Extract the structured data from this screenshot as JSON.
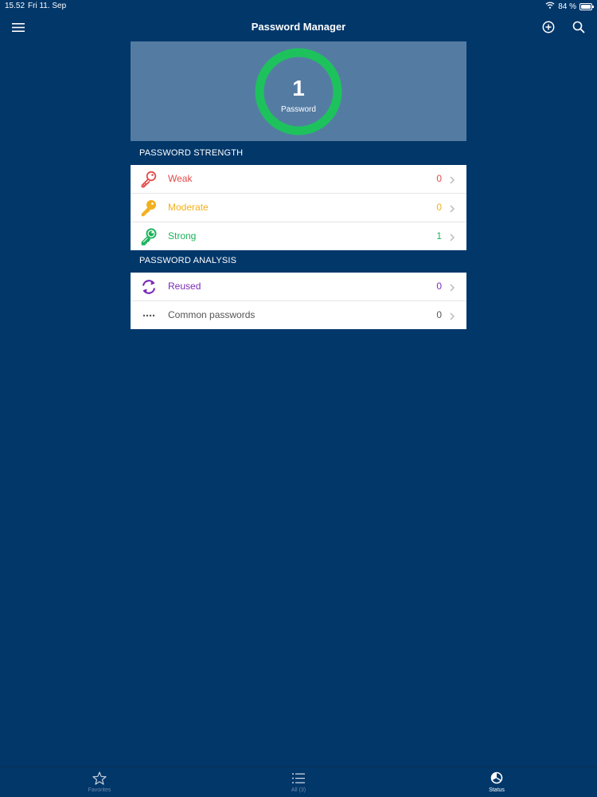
{
  "status_bar": {
    "time": "15.52",
    "date": "Fri 11. Sep",
    "battery": "84 %"
  },
  "nav": {
    "title": "Password Manager",
    "menu_icon": "hamburger-icon",
    "add_icon": "add-circle-icon",
    "search_icon": "search-icon"
  },
  "summary": {
    "count": "1",
    "label": "Password",
    "ring_color": "#1ec25d"
  },
  "strength": {
    "header": "PASSWORD STRENGTH",
    "items": [
      {
        "label": "Weak",
        "count": "0",
        "color": "#e24a4a",
        "icon": "key-icon"
      },
      {
        "label": "Moderate",
        "count": "0",
        "color": "#f2b01e",
        "icon": "key-icon"
      },
      {
        "label": "Strong",
        "count": "1",
        "color": "#1ab35a",
        "icon": "key-icon"
      }
    ]
  },
  "analysis": {
    "header": "PASSWORD ANALYSIS",
    "items": [
      {
        "label": "Reused",
        "count": "0",
        "color": "#7a2bb7",
        "icon": "refresh-icon"
      },
      {
        "label": "Common passwords",
        "count": "0",
        "color": "#555555",
        "icon": "password-dots-icon"
      }
    ]
  },
  "tabs": [
    {
      "label": "Favorites",
      "icon": "star-icon"
    },
    {
      "label": "All (3)",
      "icon": "list-icon"
    },
    {
      "label": "Status",
      "icon": "status-icon"
    }
  ],
  "colors": {
    "background": "#02376a",
    "summary_bg": "#547ca3",
    "tab_inactive": "#6f88a6",
    "tab_active": "#ffffff"
  }
}
